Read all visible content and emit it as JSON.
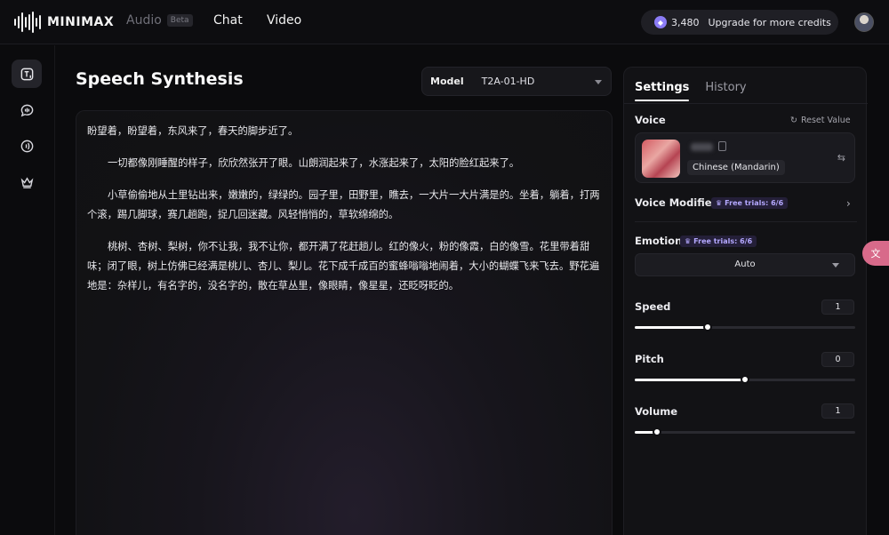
{
  "brand": {
    "name": "MINIMAX"
  },
  "nav": {
    "audio": "Audio",
    "beta": "Beta",
    "chat": "Chat",
    "video": "Video"
  },
  "credits": {
    "icon": "credit-coin-icon",
    "amount": "3,480",
    "upgrade_label": "Upgrade for more credits"
  },
  "rail": {
    "items": [
      {
        "name": "speech-synthesis",
        "icon": "text-to-speech-icon",
        "active": true
      },
      {
        "name": "voice-chat",
        "icon": "chat-bubble-icon",
        "active": false
      },
      {
        "name": "voice-clone",
        "icon": "sound-wave-icon",
        "active": false
      },
      {
        "name": "premium",
        "icon": "crown-icon",
        "active": false
      }
    ]
  },
  "main": {
    "title": "Speech Synthesis",
    "model_label": "Model",
    "model_value": "T2A-01-HD",
    "paragraphs": [
      "盼望着，盼望着，东风来了，春天的脚步近了。",
      "一切都像刚睡醒的样子，欣欣然张开了眼。山朗润起来了，水涨起来了，太阳的脸红起来了。",
      "小草偷偷地从土里钻出来，嫩嫩的，绿绿的。园子里，田野里，瞧去，一大片一大片满是的。坐着，躺着，打两个滚，踢几脚球，赛几趟跑，捉几回迷藏。风轻悄悄的，草软绵绵的。",
      "桃树、杏树、梨树，你不让我，我不让你，都开满了花赶趟儿。红的像火，粉的像霞，白的像雪。花里带着甜味；闭了眼，树上仿佛已经满是桃儿、杏儿、梨儿。花下成千成百的蜜蜂嗡嗡地闹着，大小的蝴蝶飞来飞去。野花遍地是：杂样儿，有名字的，没名字的，散在草丛里，像眼睛，像星星，还眨呀眨的。"
    ]
  },
  "panel": {
    "tabs": {
      "settings": "Settings",
      "history": "History"
    },
    "voice": {
      "label": "Voice",
      "reset": "Reset Value",
      "language": "Chinese (Mandarin)"
    },
    "voice_modifier": {
      "label": "Voice Modifier",
      "trial": "Free trials: 6/6"
    },
    "emotion": {
      "label": "Emotion",
      "trial": "Free trials: 6/6",
      "value": "Auto"
    },
    "speed": {
      "label": "Speed",
      "value": "1",
      "level": 0.33
    },
    "pitch": {
      "label": "Pitch",
      "value": "0",
      "level": 0.5
    },
    "volume": {
      "label": "Volume",
      "value": "1",
      "level": 0.1
    }
  },
  "side_tab": {
    "icon": "translate-icon"
  },
  "colors": {
    "accent": "#8b7cf6",
    "side_tab": "#d86a8a",
    "background": "#0b0b0d"
  }
}
